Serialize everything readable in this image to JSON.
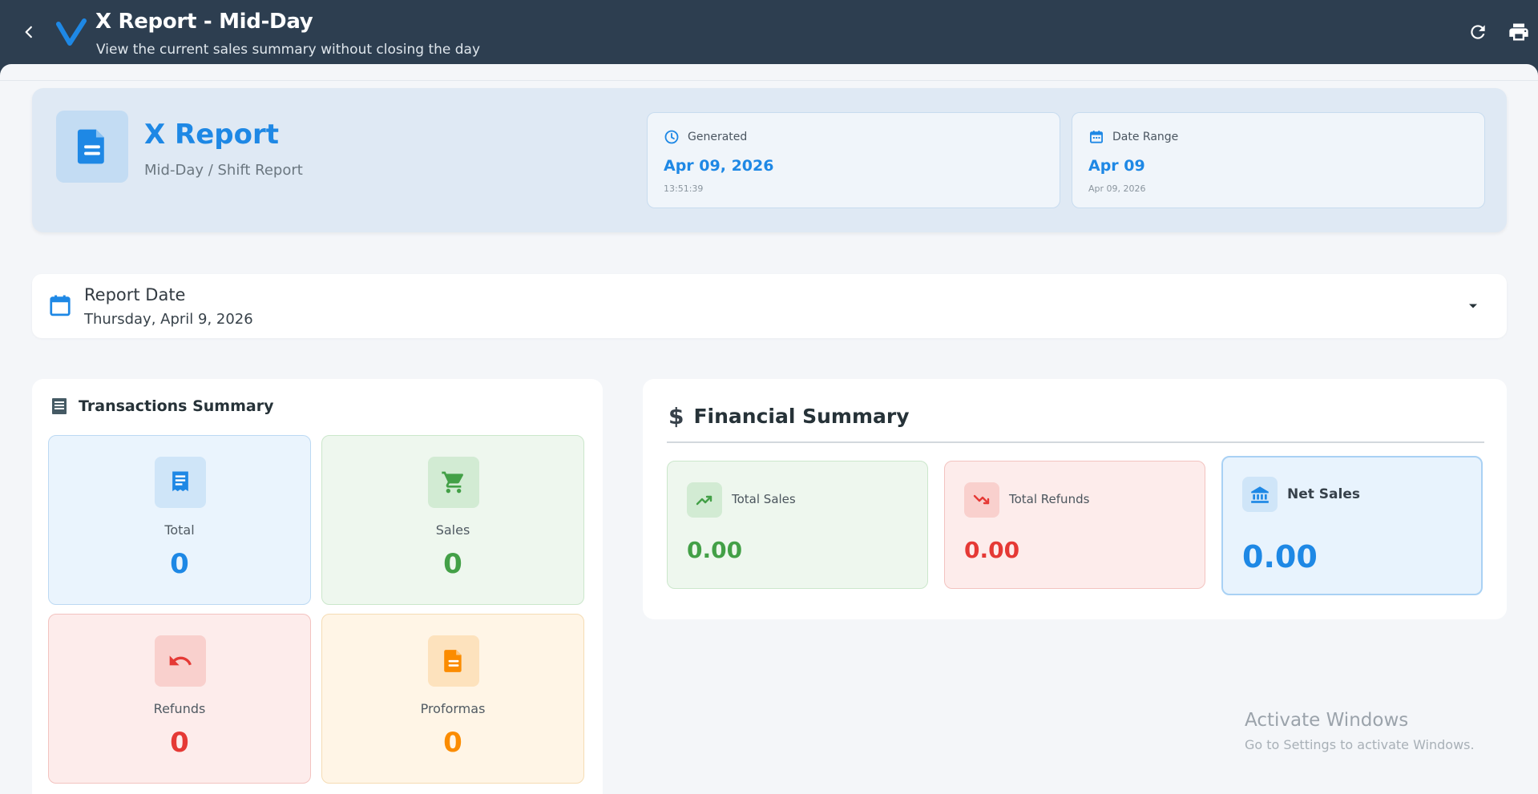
{
  "appbar": {
    "title": "X Report - Mid-Day",
    "subtitle": "View the current sales summary without closing the day"
  },
  "hero": {
    "title": "X Report",
    "subtitle": "Mid-Day / Shift Report",
    "generated": {
      "label": "Generated",
      "value": "Apr 09, 2026",
      "meta": "13:51:39"
    },
    "date_range": {
      "label": "Date Range",
      "value": "Apr 09",
      "meta": "Apr 09, 2026"
    }
  },
  "report_date": {
    "label": "Report Date",
    "value": "Thursday, April 9, 2026"
  },
  "transactions": {
    "title": "Transactions Summary",
    "items": [
      {
        "label": "Total",
        "value": "0"
      },
      {
        "label": "Sales",
        "value": "0"
      },
      {
        "label": "Refunds",
        "value": "0"
      },
      {
        "label": "Proformas",
        "value": "0"
      }
    ]
  },
  "financial": {
    "title": "Financial Summary",
    "total_sales": {
      "label": "Total Sales",
      "value": "0.00"
    },
    "total_refunds": {
      "label": "Total Refunds",
      "value": "0.00"
    },
    "net_sales": {
      "label": "Net Sales",
      "value": "0.00"
    }
  },
  "watermark": {
    "title": "Activate Windows",
    "subtitle": "Go to Settings to activate Windows."
  },
  "icons": {
    "back": "chevron-left-icon",
    "logo": "v-logo-icon",
    "refresh": "refresh-icon",
    "print": "print-icon",
    "report": "document-icon",
    "clock": "clock-icon",
    "calendar": "calendar-icon",
    "dropdown": "caret-down-icon",
    "receipt": "receipt-icon",
    "cart": "cart-icon",
    "undo": "undo-icon",
    "proforma": "proforma-document-icon",
    "dollar": "dollar-icon",
    "trend_up": "trending-up-icon",
    "trend_down": "trending-down-icon",
    "bank": "bank-icon"
  },
  "colors": {
    "header_bg": "#2d3e50",
    "page_bg": "#f4f6f9",
    "primary": "#1e88e5",
    "success": "#43a047",
    "danger": "#e53935",
    "warning": "#fb8c00"
  }
}
